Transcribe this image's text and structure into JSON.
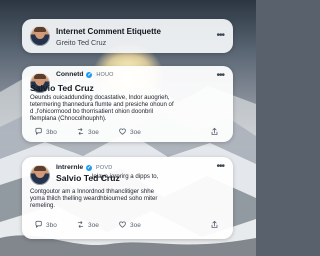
{
  "header": {
    "title": "Internet Comment Etiquette",
    "subtitle": "Greito Ted Cruz"
  },
  "posts": [
    {
      "meta_name": "Connetd",
      "meta_time": "HOUO",
      "author": "Salvio Ted Cruz",
      "body": [
        "Oeunds ouicaddunding docastative, Indor auogrieh,",
        "tetermering thannedura flumte and presiche ohoun of",
        "d ,l'ohicormood bo thorrisatient ohion doonbril",
        "flemplana (Chnocolhouphh)."
      ],
      "actions": {
        "reply": "3bo",
        "repost": "3oe",
        "like": "3oe"
      }
    },
    {
      "meta_name": "Intrernle",
      "meta_time": "POVD",
      "author": "Salvio Ted Cruz",
      "body_inline": "lelaye ierorirg a dipps to,",
      "body": [
        "Contgoutor am a Innordnod thhanclitiger shhe",
        "yoma thilch thelling weardhbiourned soho miter",
        "remeling."
      ],
      "actions": {
        "reply": "3bo",
        "repost": "3oe",
        "like": "3oe"
      }
    }
  ],
  "colors": {
    "verified": "#1d9bf0",
    "card": "#ffffff",
    "muted": "#5a6470"
  },
  "icons": {
    "more": "more-horizontal-icon",
    "reply": "reply-bubble-icon",
    "repost": "repost-arrows-icon",
    "like": "heart-icon",
    "share": "share-icon",
    "verified": "verified-badge-icon"
  }
}
